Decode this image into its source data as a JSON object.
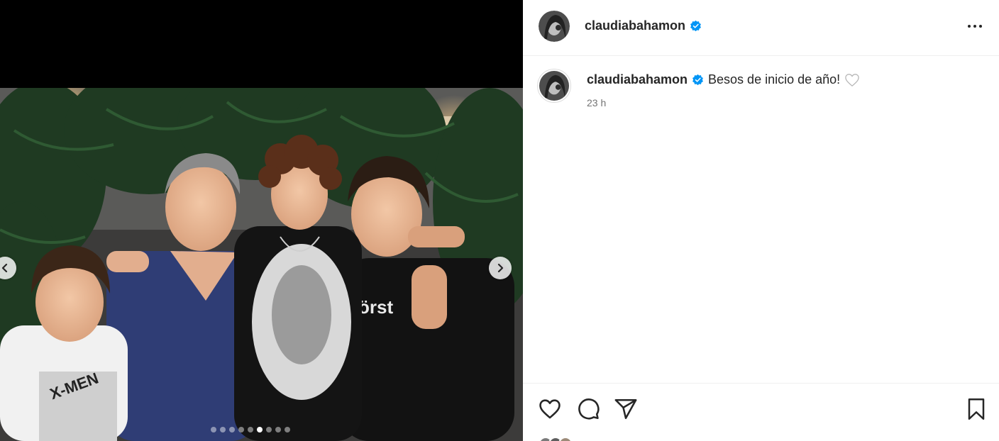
{
  "post": {
    "username": "claudiabahamon",
    "verified": true,
    "caption": "Besos de inicio de año!",
    "caption_emoji": "white-heart-emoji",
    "timestamp": "23 h"
  },
  "carousel": {
    "slide_count": 9,
    "active_index": 5,
    "prev_icon": "chevron-left-icon",
    "next_icon": "chevron-right-icon"
  },
  "actions": {
    "like_icon": "heart-icon",
    "comment_icon": "comment-icon",
    "share_icon": "share-icon",
    "save_icon": "bookmark-icon"
  },
  "colors": {
    "verified_blue": "#0095f6",
    "text_primary": "#262626",
    "text_secondary": "#737373",
    "divider": "#efefef"
  }
}
